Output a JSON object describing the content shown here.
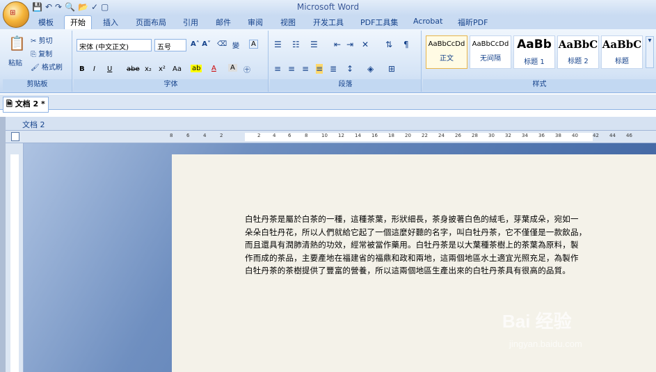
{
  "app": {
    "title": "Microsoft Word",
    "office_button": "Office"
  },
  "quick_access": [
    "save-icon",
    "undo-icon",
    "redo-icon",
    "print-preview-icon",
    "open-icon",
    "spell-icon",
    "new-icon"
  ],
  "tabs": [
    "模板",
    "开始",
    "插入",
    "页面布局",
    "引用",
    "邮件",
    "审阅",
    "视图",
    "开发工具",
    "PDF工具集",
    "Acrobat",
    "福昕PDF"
  ],
  "active_tab": "开始",
  "clipboard": {
    "paste": "粘贴",
    "cut": "剪切",
    "copy": "复制",
    "format_painter": "格式刷",
    "label": "剪贴板"
  },
  "font": {
    "name": "宋体 (中文正文)",
    "size": "五号",
    "label": "字体",
    "buttons": [
      "B",
      "I",
      "U",
      "abe",
      "x₂",
      "x²",
      "Aa",
      "A",
      "A"
    ]
  },
  "paragraph": {
    "label": "段落"
  },
  "styles": {
    "label": "样式",
    "items": [
      {
        "preview": "AaBbCcDd",
        "name": "正文"
      },
      {
        "preview": "AaBbCcDd",
        "name": "无间隔"
      },
      {
        "preview": "AaBb",
        "name": "标题 1"
      },
      {
        "preview": "AaBbC",
        "name": "标题 2"
      },
      {
        "preview": "AaBbC",
        "name": "标题"
      }
    ]
  },
  "doc_tab": "文档 2 *",
  "window_title": "文档 2",
  "ruler_ticks": [
    "8",
    "6",
    "4",
    "2",
    "2",
    "4",
    "6",
    "8",
    "10",
    "12",
    "14",
    "16",
    "18",
    "20",
    "22",
    "24",
    "26",
    "28",
    "30",
    "32",
    "34",
    "36",
    "38",
    "40",
    "42",
    "44",
    "46"
  ],
  "document": {
    "lines": [
      "白牡丹茶是屬於白茶的一種，這種茶葉，形狀細長，茶身披著白色的絨毛，芽葉成朵，宛如一",
      "朵朵白牡丹花，所以人們就給它起了一個這麼好聽的名字，叫白牡丹茶，它不僅僅是一款飲品，",
      "而且還具有潤肺清熱的功效，經常被當作藥用。白牡丹茶是以大葉種茶樹上的茶葉為原料，製",
      "作而成的茶品，主要產地在福建省的福鼎和政和兩地，這兩個地區水土適宜光照充足，為製作",
      "白牡丹茶的茶樹提供了豐富的營養，所以這兩個地區生產出來的白牡丹茶具有很高的品質。"
    ]
  },
  "watermark": {
    "brand": "Bai 经验",
    "url": "jingyan.baidu.com"
  }
}
